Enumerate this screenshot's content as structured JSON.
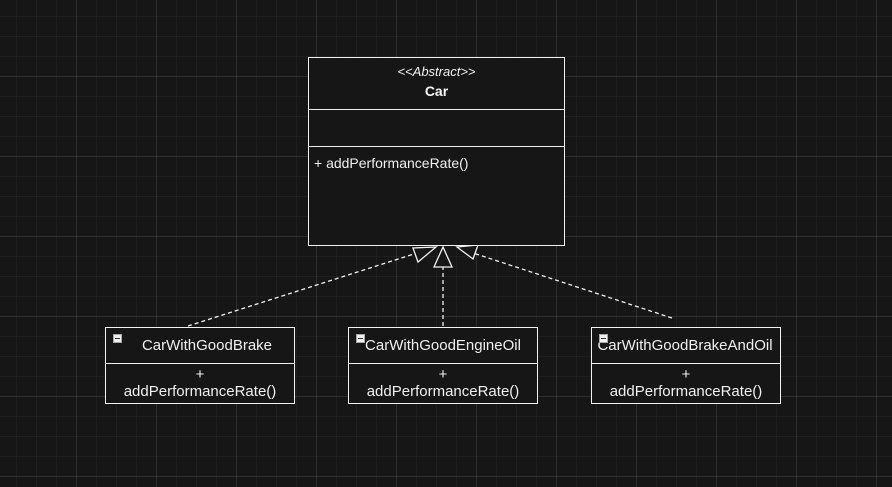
{
  "abstract_class": {
    "stereotype": "<<Abstract>>",
    "name": "Car",
    "attributes": [],
    "operations": [
      "+ addPerformanceRate()"
    ]
  },
  "subclasses": [
    {
      "name": "CarWithGoodBrake",
      "operation_visibility": "+",
      "operation_name": "addPerformanceRate()"
    },
    {
      "name": "CarWithGoodEngineOil",
      "operation_visibility": "+",
      "operation_name": "addPerformanceRate()"
    },
    {
      "name": "CarWithGoodBrakeAndOil",
      "operation_visibility": "+",
      "operation_name": "addPerformanceRate()"
    }
  ],
  "relationships": [
    {
      "from": "CarWithGoodBrake",
      "to": "Car",
      "type": "realization"
    },
    {
      "from": "CarWithGoodEngineOil",
      "to": "Car",
      "type": "realization"
    },
    {
      "from": "CarWithGoodBrakeAndOil",
      "to": "Car",
      "type": "realization"
    }
  ],
  "colors": {
    "background": "#161616",
    "stroke": "#f2f2f2",
    "text": "#f0f0f0"
  }
}
